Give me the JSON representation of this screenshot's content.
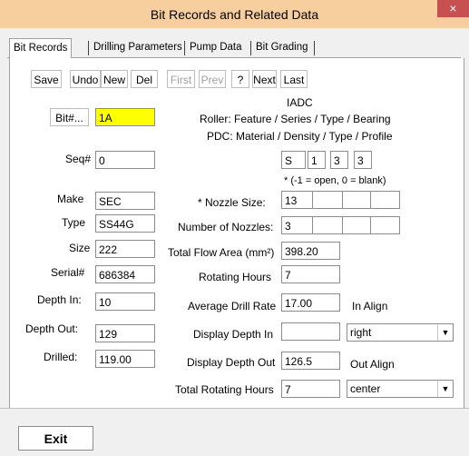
{
  "window": {
    "title": "Bit Records and Related Data",
    "close_label": "×"
  },
  "tabs": [
    {
      "label": "Bit Records"
    },
    {
      "label": "Drilling Parameters"
    },
    {
      "label": "Pump Data"
    },
    {
      "label": "Bit Grading"
    }
  ],
  "toolbar": {
    "save": "Save",
    "undo": "Undo",
    "new": "New",
    "del": "Del",
    "first": "First",
    "prev": "Prev",
    "help": "?",
    "next": "Next",
    "last": "Last"
  },
  "left": {
    "bit_button": "Bit#...",
    "bit_value": "1A",
    "seq_label": "Seq#",
    "seq_value": "0",
    "make_label": "Make",
    "make_value": "SEC",
    "type_label": "Type",
    "type_value": "SS44G",
    "size_label": "Size",
    "size_value": "222",
    "serial_label": "Serial#",
    "serial_value": "686384",
    "depth_in_label": "Depth In:",
    "depth_in_value": "10",
    "depth_out_label": "Depth Out:",
    "depth_out_value": "129",
    "drilled_label": "Drilled:",
    "drilled_value": "119.00"
  },
  "iadc": {
    "title": "IADC",
    "roller": "Roller: Feature / Series / Type / Bearing",
    "pdc": "PDC: Material / Density / Type / Profile",
    "codes": [
      "S",
      "1",
      "3",
      "3"
    ],
    "nozzle_note": "*  (-1 = open, 0 = blank)"
  },
  "right": {
    "nozzle_size_label": "* Nozzle Size:",
    "nozzle_sizes": [
      "13",
      "",
      "",
      ""
    ],
    "nozzle_count_label": "Number of Nozzles:",
    "nozzle_counts": [
      "3",
      "",
      "",
      ""
    ],
    "tfa_label": "Total Flow Area (mm²)",
    "tfa_value": "398.20",
    "rot_hours_label": "Rotating Hours",
    "rot_hours_value": "7",
    "avg_rate_label": "Average Drill Rate",
    "avg_rate_value": "17.00",
    "in_align_label": "In Align",
    "disp_depth_in_label": "Display Depth In",
    "disp_depth_in_value": "",
    "in_align_value": "right",
    "disp_depth_out_label": "Display Depth Out",
    "disp_depth_out_value": "126.5",
    "out_align_label": "Out Align",
    "total_rot_label": "Total Rotating Hours",
    "total_rot_value": "7",
    "out_align_value": "center"
  },
  "footer": {
    "exit": "Exit"
  }
}
